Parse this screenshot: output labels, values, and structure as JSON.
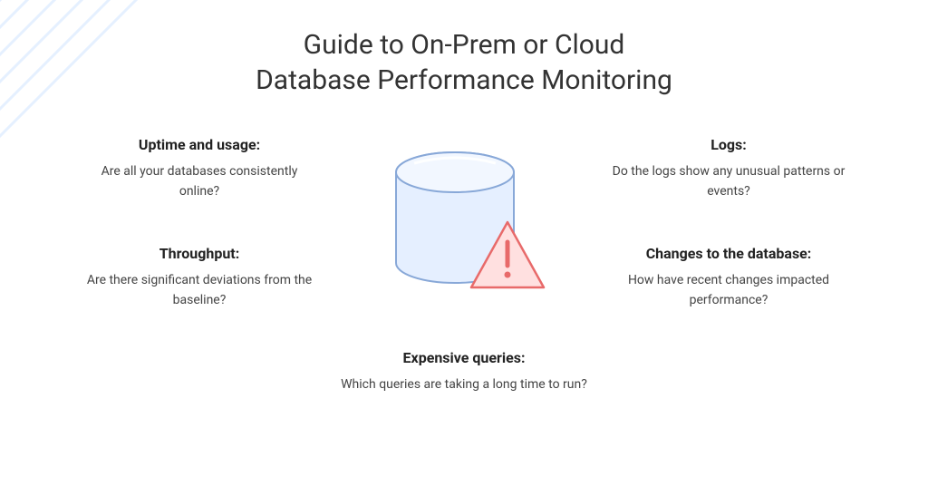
{
  "title": {
    "line1": "Guide to On-Prem or Cloud",
    "line2": "Database Performance Monitoring"
  },
  "items": {
    "uptime": {
      "title": "Uptime and usage:",
      "desc": "Are all your databases consistently online?"
    },
    "throughput": {
      "title": "Throughput:",
      "desc": "Are there significant deviations from the baseline?"
    },
    "logs": {
      "title": "Logs:",
      "desc": "Do the logs show any unusual patterns or events?"
    },
    "changes": {
      "title": "Changes to the database:",
      "desc": "How have recent changes impacted performance?"
    },
    "queries": {
      "title": "Expensive queries:",
      "desc": "Which queries are taking a long time to run?"
    }
  },
  "icons": {
    "center": "database-warning-icon"
  },
  "colors": {
    "db_fill": "#e5efff",
    "db_stroke": "#88a8d8",
    "warn_fill": "#ffe0e0",
    "warn_stroke": "#e86a6a"
  }
}
